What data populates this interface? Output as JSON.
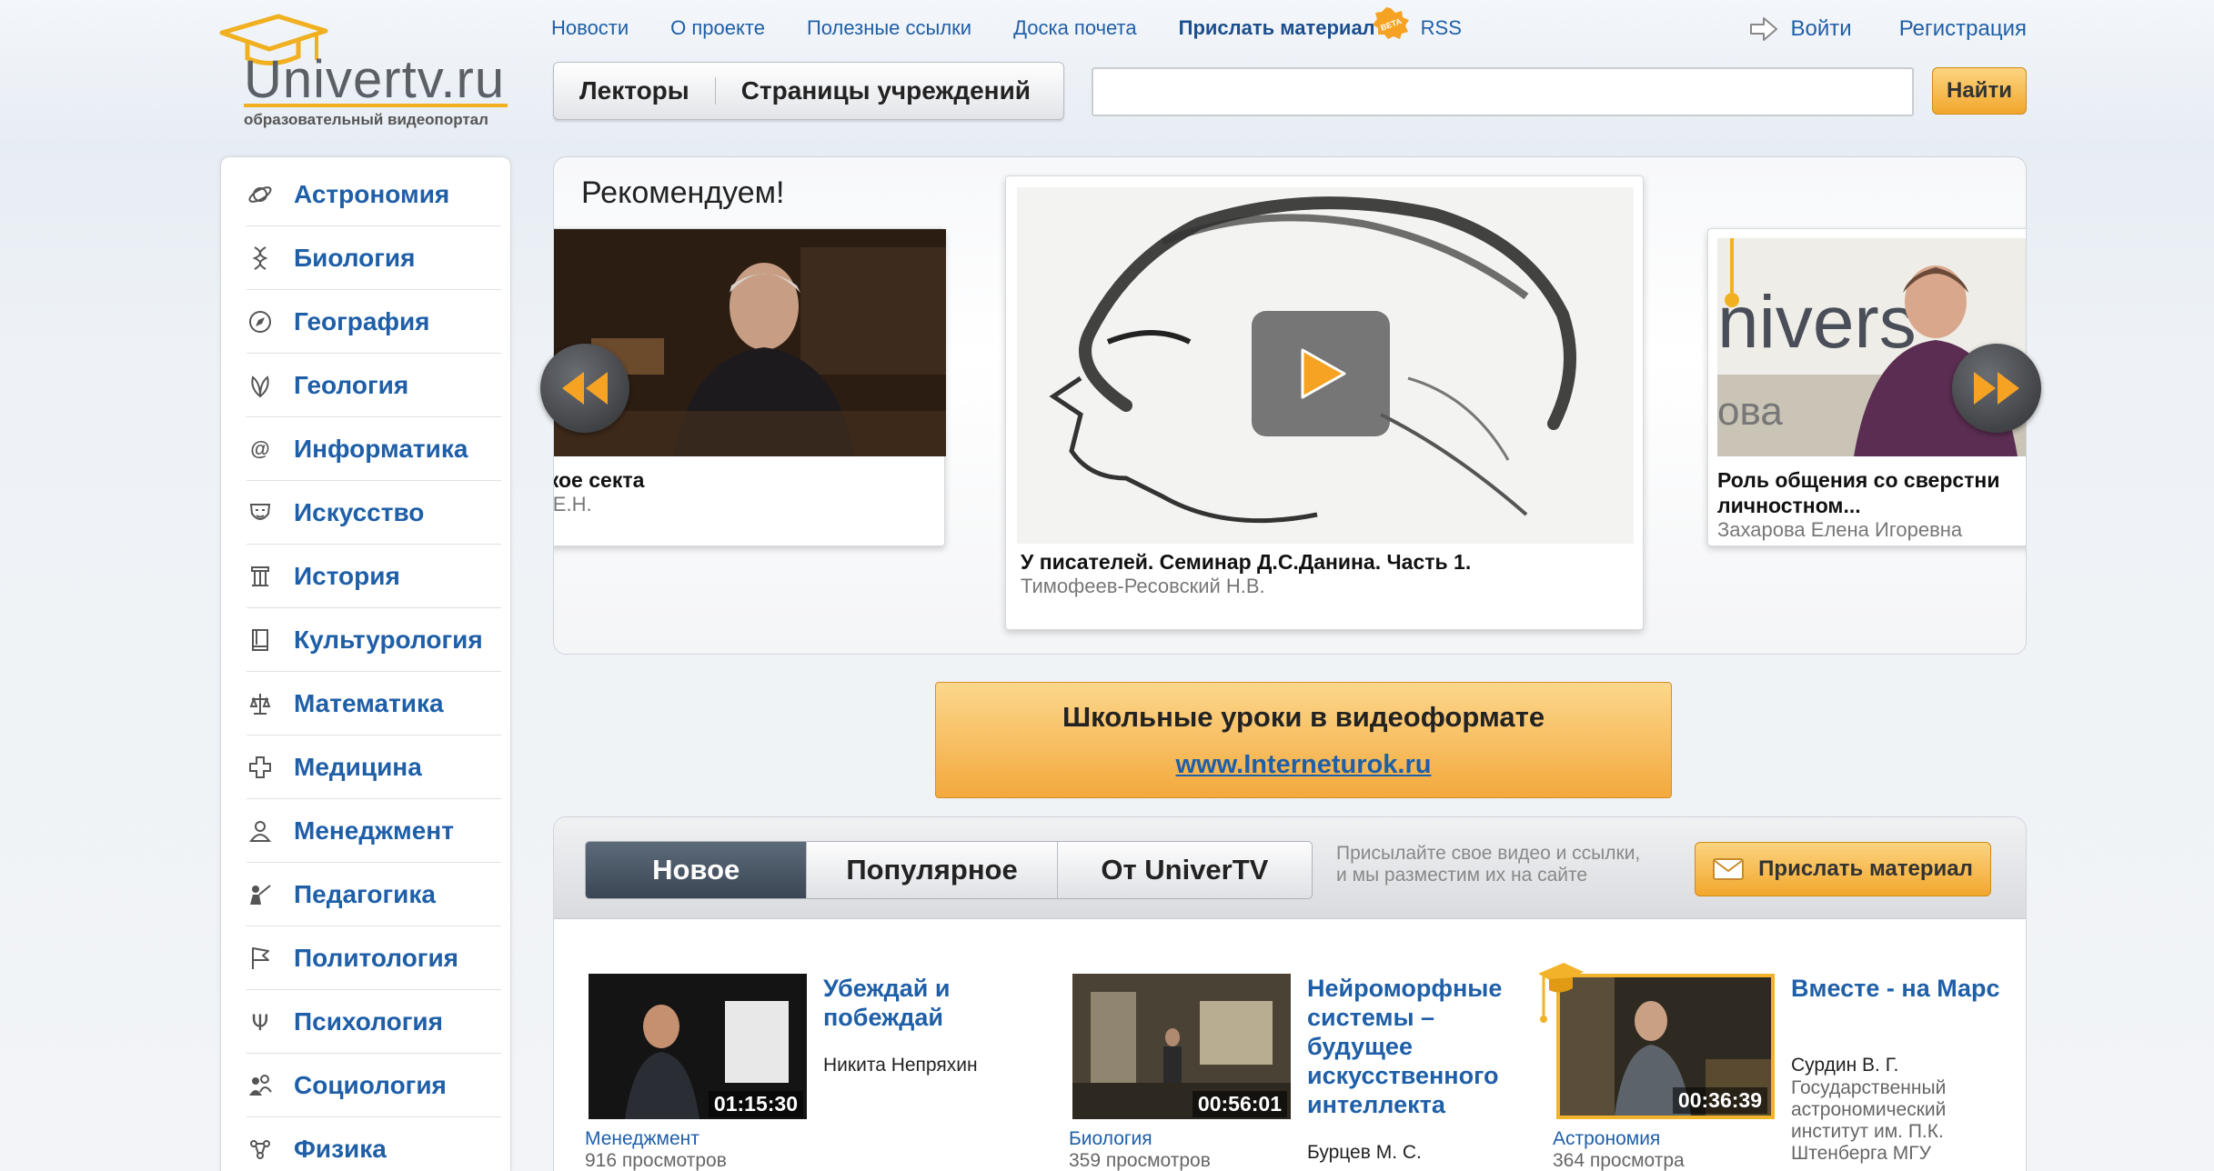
{
  "logo": {
    "title": "Univertv.ru",
    "subtitle": "образовательный видеопортал"
  },
  "topnav": {
    "news": "Новости",
    "about": "О проекте",
    "links": "Полезные ссылки",
    "honor": "Доска почета",
    "send": "Прислать материал",
    "beta": "BETA",
    "rss": "RSS"
  },
  "auth": {
    "login": "Войти",
    "register": "Регистрация"
  },
  "header_tabs": {
    "lecturers": "Лекторы",
    "institutions": "Страницы учреждений"
  },
  "search": {
    "value": "",
    "button": "Найти"
  },
  "sidebar": {
    "items": [
      {
        "label": "Астрономия",
        "icon": "planet-icon"
      },
      {
        "label": "Биология",
        "icon": "dna-icon"
      },
      {
        "label": "География",
        "icon": "compass-icon"
      },
      {
        "label": "Геология",
        "icon": "leaf-icon"
      },
      {
        "label": "Информатика",
        "icon": "at-icon"
      },
      {
        "label": "Искусство",
        "icon": "mask-icon"
      },
      {
        "label": "История",
        "icon": "column-icon"
      },
      {
        "label": "Культурология",
        "icon": "book-icon"
      },
      {
        "label": "Математика",
        "icon": "scales-icon"
      },
      {
        "label": "Медицина",
        "icon": "cross-icon"
      },
      {
        "label": "Менеджмент",
        "icon": "person-icon"
      },
      {
        "label": "Педагогика",
        "icon": "teacher-icon"
      },
      {
        "label": "Политология",
        "icon": "flag-icon"
      },
      {
        "label": "Психология",
        "icon": "psi-icon"
      },
      {
        "label": "Социология",
        "icon": "people-icon"
      },
      {
        "label": "Физика",
        "icon": "atom-icon"
      }
    ]
  },
  "reco": {
    "title": "Рекомендуем!",
    "left": {
      "title": "акое секта",
      "author": "в Е.Н."
    },
    "center": {
      "title": "У писателей. Семинар Д.С.Данина. Часть 1.",
      "author": "Тимофеев-Ресовский Н.В."
    },
    "right": {
      "title": "Роль общения со сверстни личностном...",
      "author": "Захарова Елена Игоревна"
    }
  },
  "banner": {
    "line1": "Школьные уроки в видеоформате",
    "link": "www.Interneturok.ru"
  },
  "videos": {
    "tabs": [
      "Новое",
      "Популярное",
      "От UniverTV"
    ],
    "note": [
      "Присылайте свое видео и ссылки,",
      "и мы разместим их на сайте"
    ],
    "send_button": "Прислать материал",
    "items": [
      {
        "title": "Убеждай и побеждай",
        "author": "Никита Непряхин",
        "org": "",
        "duration": "01:15:30",
        "category": "Менеджмент",
        "views": "916 просмотров"
      },
      {
        "title": "Нейроморфные системы – будущее искусственного интеллекта",
        "author": "Бурцев М. С.",
        "org": "",
        "duration": "00:56:01",
        "category": "Биология",
        "views": "359 просмотров"
      },
      {
        "title": "Вместе - на Марс",
        "author": "Сурдин В. Г.",
        "org": "Государственный астрономический институт им. П.К. Штенберга МГУ",
        "duration": "00:36:39",
        "category": "Астрономия",
        "views": "364 просмотра"
      }
    ]
  },
  "colors": {
    "link": "#1f5fa8",
    "accent": "#f2a72d",
    "active_tab": "#3a4654"
  }
}
